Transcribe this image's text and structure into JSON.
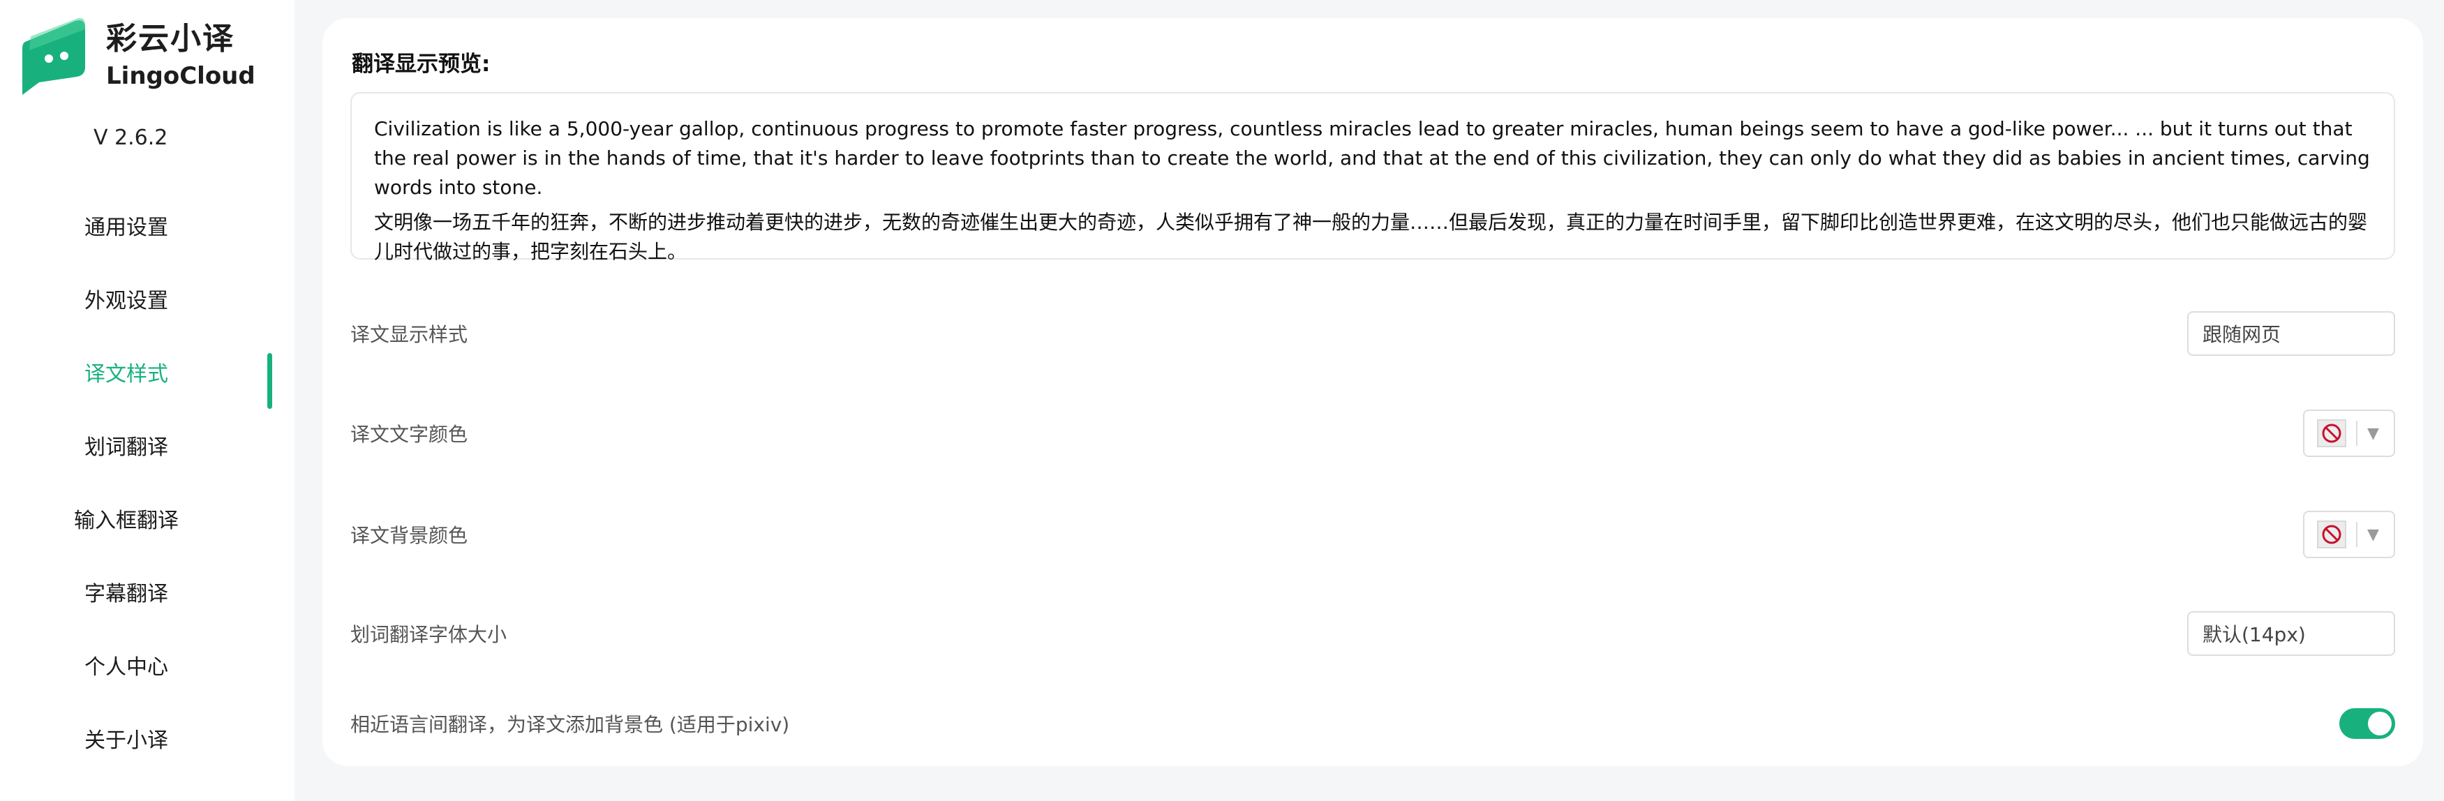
{
  "app": {
    "name_cn": "彩云小译",
    "name_en": "LingoCloud",
    "version": "V 2.6.2",
    "brand_color": "#18b17d"
  },
  "sidebar": {
    "items": [
      {
        "label": "通用设置",
        "active": false
      },
      {
        "label": "外观设置",
        "active": false
      },
      {
        "label": "译文样式",
        "active": true
      },
      {
        "label": "划词翻译",
        "active": false
      },
      {
        "label": "输入框翻译",
        "active": false
      },
      {
        "label": "字幕翻译",
        "active": false
      },
      {
        "label": "个人中心",
        "active": false
      },
      {
        "label": "关于小译",
        "active": false
      }
    ]
  },
  "preview": {
    "title": "翻译显示预览:",
    "text_en": "Civilization is like a 5,000-year gallop, continuous progress to promote faster progress, countless miracles lead to greater miracles, human beings seem to have a god-like power... ... but it turns out that the real power is in the hands of time, that it's harder to leave footprints than to create the world, and that at the end of this civilization, they can only do what they did as babies in ancient times, carving words into stone.",
    "text_cn": "文明像一场五千年的狂奔，不断的进步推动着更快的进步，无数的奇迹催生出更大的奇迹，人类似乎拥有了神一般的力量……但最后发现，真正的力量在时间手里，留下脚印比创造世界更难，在这文明的尽头，他们也只能做远古的婴儿时代做过的事，把字刻在石头上。"
  },
  "settings": {
    "display_style": {
      "label": "译文显示样式",
      "value": "跟随网页"
    },
    "text_color": {
      "label": "译文文字颜色",
      "value_icon": "no-color-icon"
    },
    "bg_color": {
      "label": "译文背景颜色",
      "value_icon": "no-color-icon"
    },
    "font_size": {
      "label": "划词翻译字体大小",
      "value": "默认(14px)"
    },
    "similar_lang_bg": {
      "label": "相近语言间翻译，为译文添加背景色 (适用于pixiv)",
      "enabled": true
    }
  }
}
